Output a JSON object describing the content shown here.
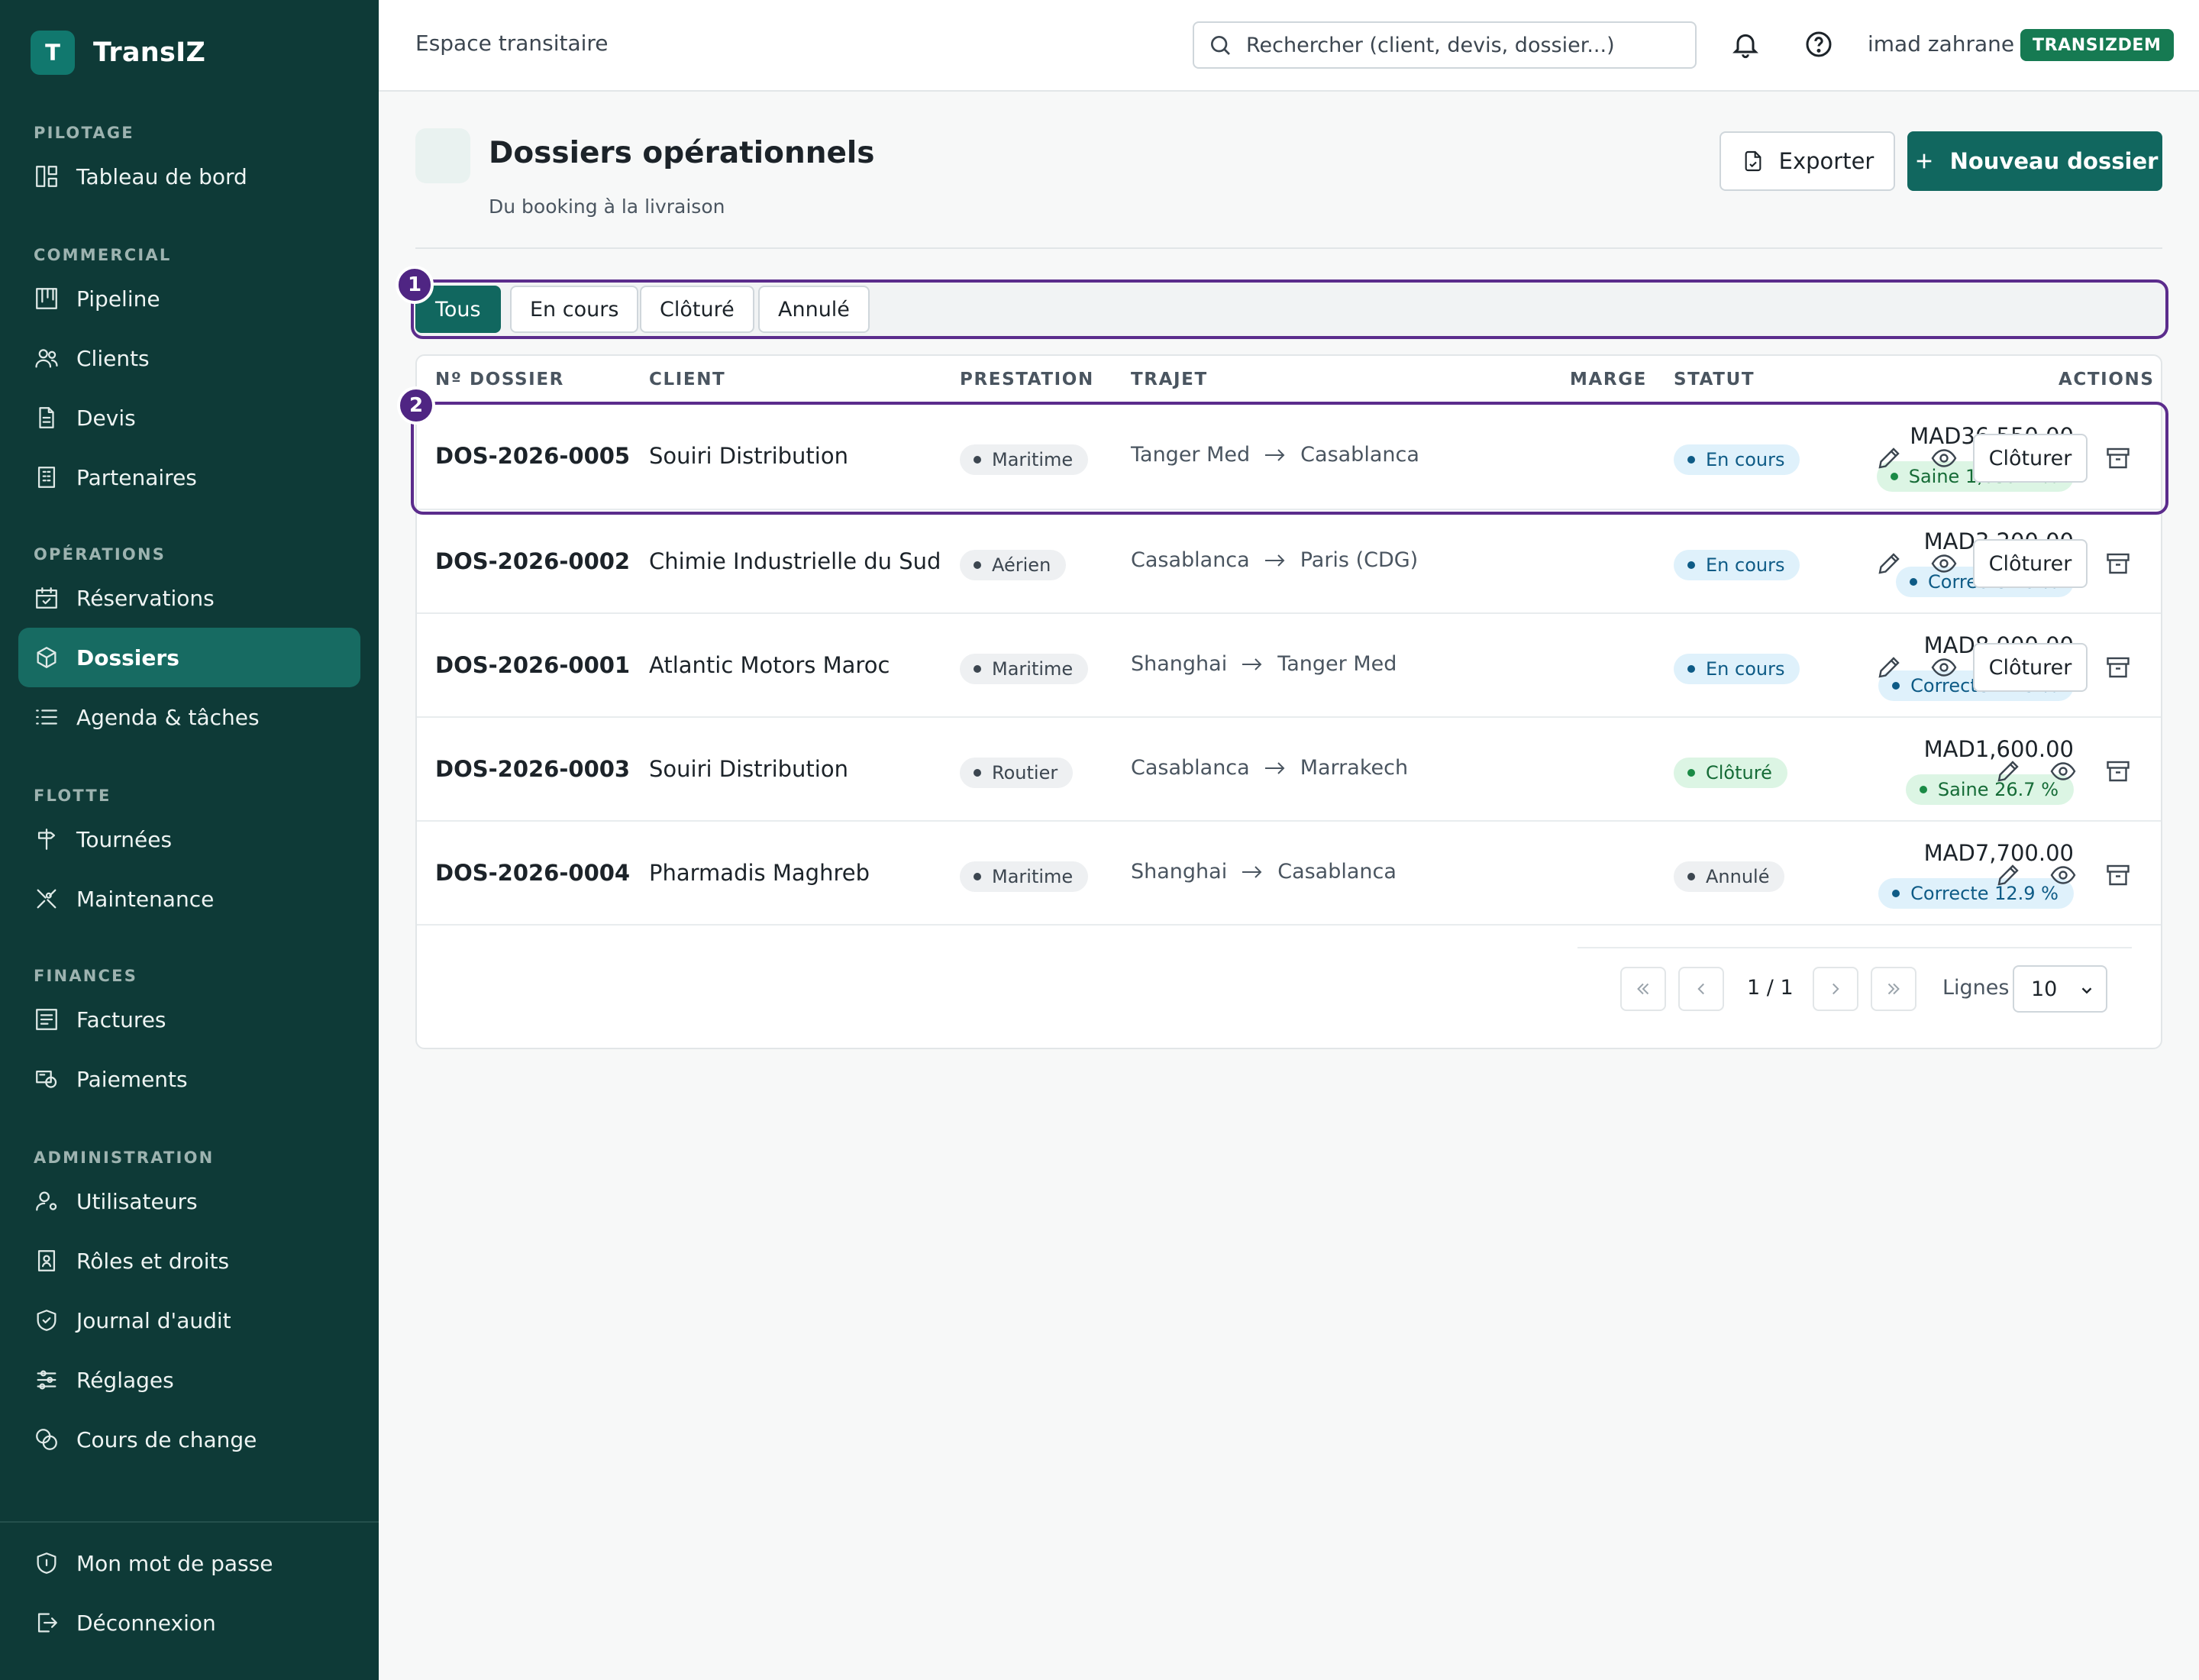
{
  "app": {
    "brand_letter": "T",
    "brand_name": "TransIZ"
  },
  "sidebar": {
    "sections": [
      {
        "title": "PILOTAGE",
        "items": [
          {
            "label": "Tableau de bord",
            "icon": "dashboard-icon"
          }
        ]
      },
      {
        "title": "COMMERCIAL",
        "items": [
          {
            "label": "Pipeline",
            "icon": "kanban-icon"
          },
          {
            "label": "Clients",
            "icon": "users-icon"
          },
          {
            "label": "Devis",
            "icon": "document-icon"
          },
          {
            "label": "Partenaires",
            "icon": "building-icon"
          }
        ]
      },
      {
        "title": "OPÉRATIONS",
        "items": [
          {
            "label": "Réservations",
            "icon": "calendar-check-icon"
          },
          {
            "label": "Dossiers",
            "icon": "package-icon",
            "active": true
          },
          {
            "label": "Agenda & tâches",
            "icon": "list-icon"
          }
        ]
      },
      {
        "title": "FLOTTE",
        "items": [
          {
            "label": "Tournées",
            "icon": "signpost-icon"
          },
          {
            "label": "Maintenance",
            "icon": "tools-icon"
          }
        ]
      },
      {
        "title": "FINANCES",
        "items": [
          {
            "label": "Factures",
            "icon": "invoice-icon"
          },
          {
            "label": "Paiements",
            "icon": "payment-icon"
          }
        ]
      },
      {
        "title": "ADMINISTRATION",
        "items": [
          {
            "label": "Utilisateurs",
            "icon": "user-settings-icon"
          },
          {
            "label": "Rôles et droits",
            "icon": "badge-icon"
          },
          {
            "label": "Journal d'audit",
            "icon": "shield-check-icon"
          },
          {
            "label": "Réglages",
            "icon": "sliders-icon"
          },
          {
            "label": "Cours de change",
            "icon": "coins-icon"
          }
        ]
      }
    ],
    "footer": [
      {
        "label": "Mon mot de passe",
        "icon": "shield-icon"
      },
      {
        "label": "Déconnexion",
        "icon": "logout-icon"
      }
    ]
  },
  "topbar": {
    "breadcrumb": "Espace transitaire",
    "search_placeholder": "Rechercher (client, devis, dossier...)",
    "user_name": "imad zahrane",
    "tenant": "TRANSIZDEM"
  },
  "page": {
    "title": "Dossiers opérationnels",
    "subtitle": "Du booking à la livraison",
    "export_label": "Exporter",
    "new_label": "Nouveau dossier"
  },
  "filters": {
    "tabs": [
      "Tous",
      "En cours",
      "Clôturé",
      "Annulé"
    ],
    "active": "Tous"
  },
  "annotations": {
    "badge_1": "1",
    "badge_2": "2"
  },
  "table": {
    "columns": {
      "dossier": "Nº DOSSIER",
      "client": "CLIENT",
      "prestation": "PRESTATION",
      "trajet": "TRAJET",
      "marge": "MARGE",
      "statut": "STATUT",
      "actions": "ACTIONS"
    },
    "close_label": "Clôturer",
    "rows": [
      {
        "id": "DOS-2026-0005",
        "client": "Souiri Distribution",
        "prestation": "Maritime",
        "from": "Tanger Med",
        "to": "Casablanca",
        "amount": "MAD36,550.00",
        "margin": "Saine 1,059.4 %",
        "margin_level": "good",
        "status": "En cours",
        "status_level": "open"
      },
      {
        "id": "DOS-2026-0002",
        "client": "Chimie Industrielle du Sud",
        "prestation": "Aérien",
        "from": "Casablanca",
        "to": "Paris (CDG)",
        "amount": "MAD3,200.00",
        "margin": "Correcte 16 %",
        "margin_level": "ok",
        "status": "En cours",
        "status_level": "open"
      },
      {
        "id": "DOS-2026-0001",
        "client": "Atlantic Motors Maroc",
        "prestation": "Maritime",
        "from": "Shanghai",
        "to": "Tanger Med",
        "amount": "MAD8,000.00",
        "margin": "Correcte 14.3 %",
        "margin_level": "ok",
        "status": "En cours",
        "status_level": "open"
      },
      {
        "id": "DOS-2026-0003",
        "client": "Souiri Distribution",
        "prestation": "Routier",
        "from": "Casablanca",
        "to": "Marrakech",
        "amount": "MAD1,600.00",
        "margin": "Saine 26.7 %",
        "margin_level": "good",
        "status": "Clôturé",
        "status_level": "closed"
      },
      {
        "id": "DOS-2026-0004",
        "client": "Pharmadis Maghreb",
        "prestation": "Maritime",
        "from": "Shanghai",
        "to": "Casablanca",
        "amount": "MAD7,700.00",
        "margin": "Correcte 12.9 %",
        "margin_level": "ok",
        "status": "Annulé",
        "status_level": "cancel"
      }
    ]
  },
  "pagination": {
    "info": "1 / 1",
    "lines_label": "Lignes",
    "page_size": "10"
  },
  "colors": {
    "sidebar": "#0e3a37",
    "primary": "#11675f",
    "highlight": "#5b2c8c",
    "tenant": "#167a52"
  }
}
